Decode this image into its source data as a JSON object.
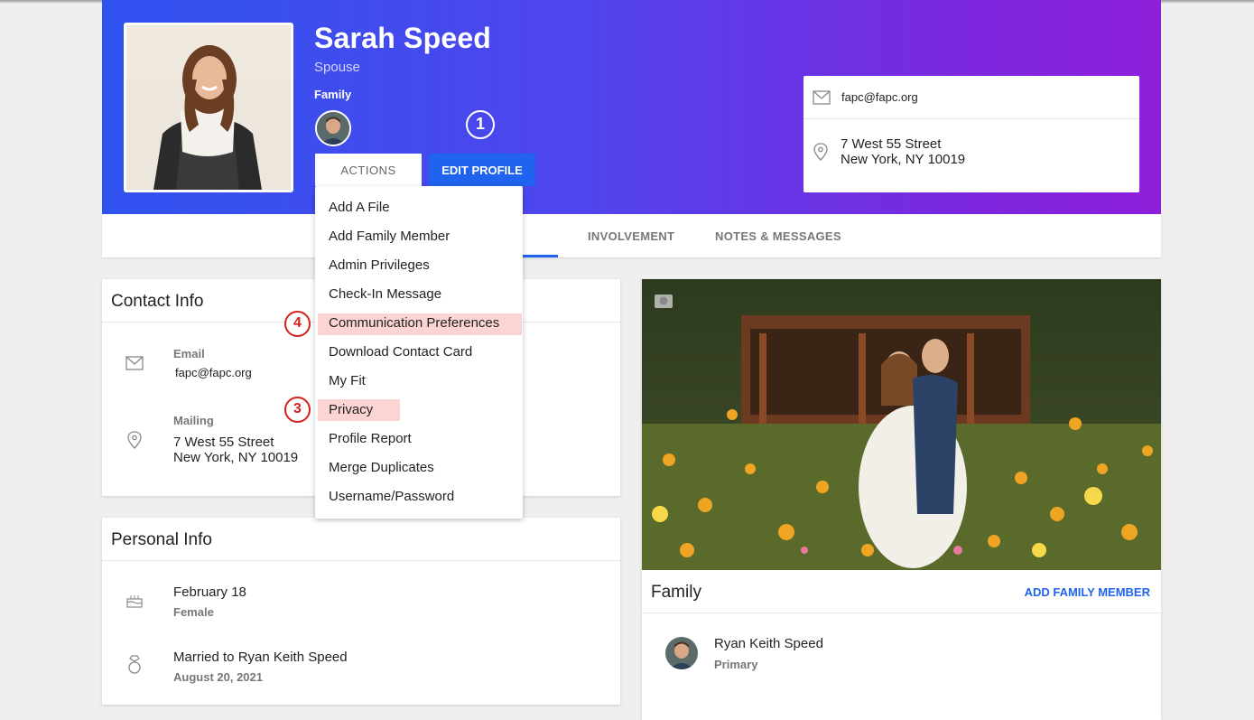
{
  "profile": {
    "name": "Sarah Speed",
    "role": "Spouse",
    "family_label": "Family",
    "actions_label": "ACTIONS",
    "edit_label": "EDIT PROFILE",
    "email": "fapc@fapc.org",
    "address_line1": "7 West 55 Street",
    "address_line2": "New York, NY 10019"
  },
  "markers": {
    "m1": "1",
    "m3": "3",
    "m4": "4"
  },
  "tabs": [
    {
      "label": "INVOLVEMENT"
    },
    {
      "label": "NOTES & MESSAGES"
    }
  ],
  "actions_menu": [
    "Add A File",
    "Add Family Member",
    "Admin Privileges",
    "Check-In Message",
    "Communication Preferences",
    "Download Contact Card",
    "My Fit",
    "Privacy",
    "Profile Report",
    "Merge Duplicates",
    "Username/Password"
  ],
  "contact_info": {
    "title": "Contact Info",
    "email_label": "Email",
    "email": "fapc@fapc.org",
    "mailing_label": "Mailing",
    "address_line1": "7 West 55 Street",
    "address_line2": "New York, NY 10019"
  },
  "personal_info": {
    "title": "Personal Info",
    "birthday": "February 18",
    "gender": "Female",
    "married": "Married to Ryan Keith Speed",
    "anniversary": "August 20, 2021"
  },
  "family_card": {
    "title": "Family",
    "add_label": "ADD FAMILY MEMBER",
    "member_name": "Ryan Keith Speed",
    "member_role": "Primary"
  },
  "colors": {
    "accent": "#1f63ee",
    "header_start": "#2f53f0",
    "header_end": "#8f1fd9",
    "highlight": "#fcd4d4",
    "marker_red": "#d42020"
  }
}
